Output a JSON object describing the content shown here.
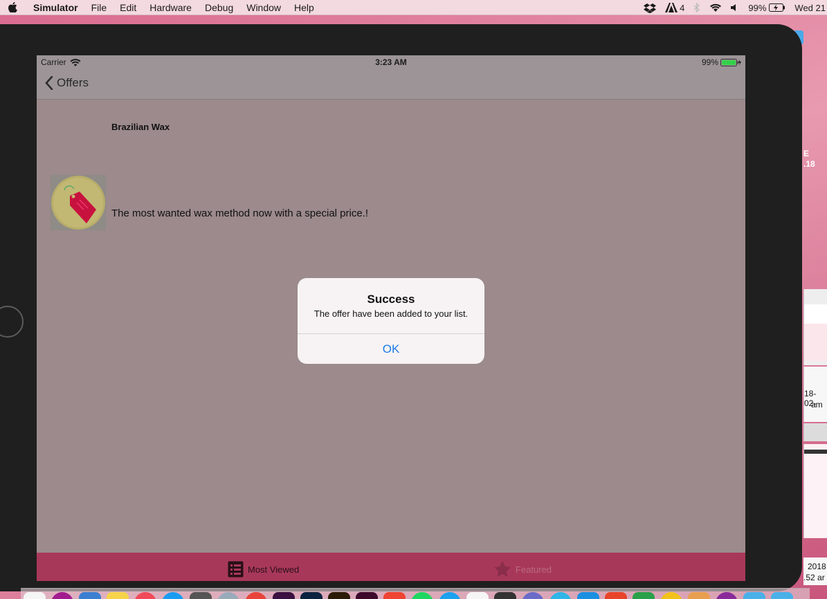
{
  "menubar": {
    "app_name": "Simulator",
    "items": [
      "File",
      "Edit",
      "Hardware",
      "Debug",
      "Window",
      "Help"
    ],
    "adobe_count": "4",
    "battery": "99%",
    "clock": "Wed 21"
  },
  "desktop": {
    "label_e": "E",
    "label_18": ".18",
    "file_label_1a": "18-02-",
    "file_label_1b": "am",
    "file_label_2a": "2018",
    "file_label_2b": ".52 ar"
  },
  "device": {
    "status": {
      "carrier": "Carrier",
      "time": "3:23 AM",
      "battery": "99%"
    },
    "nav": {
      "back_label": "Offers"
    },
    "offer": {
      "title": "Brazilian Wax",
      "description": "The most wanted wax method now with a special price.!"
    },
    "alert": {
      "title": "Success",
      "message": "The offer have been added to your list.",
      "ok_label": "OK"
    },
    "tabs": [
      {
        "label": "Most Viewed",
        "icon": "list-icon",
        "selected": true
      },
      {
        "label": "Featured",
        "icon": "star-icon",
        "selected": false
      }
    ]
  },
  "colors": {
    "screen_bg": "#9c8a8c",
    "tabbar_bg": "#a8385a",
    "alert_button": "#1a7ae8",
    "battery_fill": "#33d14a"
  }
}
